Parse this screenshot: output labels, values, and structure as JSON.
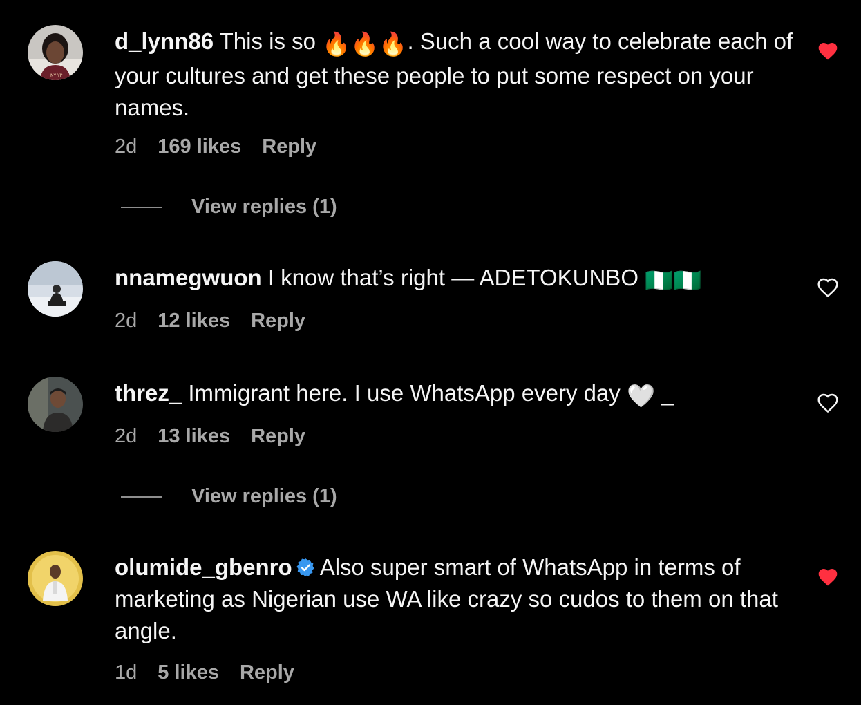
{
  "colors": {
    "background": "#000000",
    "text": "#f5f5f5",
    "secondary": "#a8a8a8",
    "liked_heart": "#ff3040",
    "verified_badge": "#3897f0"
  },
  "comments": [
    {
      "username": "d_lynn86",
      "text_before_emoji": "This is so ",
      "emoji": "🔥🔥🔥",
      "text_after_emoji": ". Such a cool way to celebrate each of your cultures and get these people to put some respect on your names.",
      "time": "2d",
      "likes": "169 likes",
      "reply": "Reply",
      "liked": true,
      "view_replies": "View replies (1)"
    },
    {
      "username": "nnamegwuon",
      "text": "I know that’s right — ADETOKUNBO ",
      "emoji": "🇳🇬🇳🇬",
      "time": "2d",
      "likes": "12 likes",
      "reply": "Reply",
      "liked": false
    },
    {
      "username": "threz_",
      "text": "Immigrant here. I use WhatsApp every day ",
      "emoji": "🤍",
      "text_after_emoji": " _",
      "time": "2d",
      "likes": "13 likes",
      "reply": "Reply",
      "liked": false,
      "view_replies": "View replies (1)"
    },
    {
      "username": "olumide_gbenro",
      "verified": true,
      "text": "Also super smart of WhatsApp in terms of marketing as Nigerian use WA like crazy so cudos to them on that angle.",
      "time": "1d",
      "likes": "5 likes",
      "reply": "Reply",
      "liked": true
    }
  ]
}
